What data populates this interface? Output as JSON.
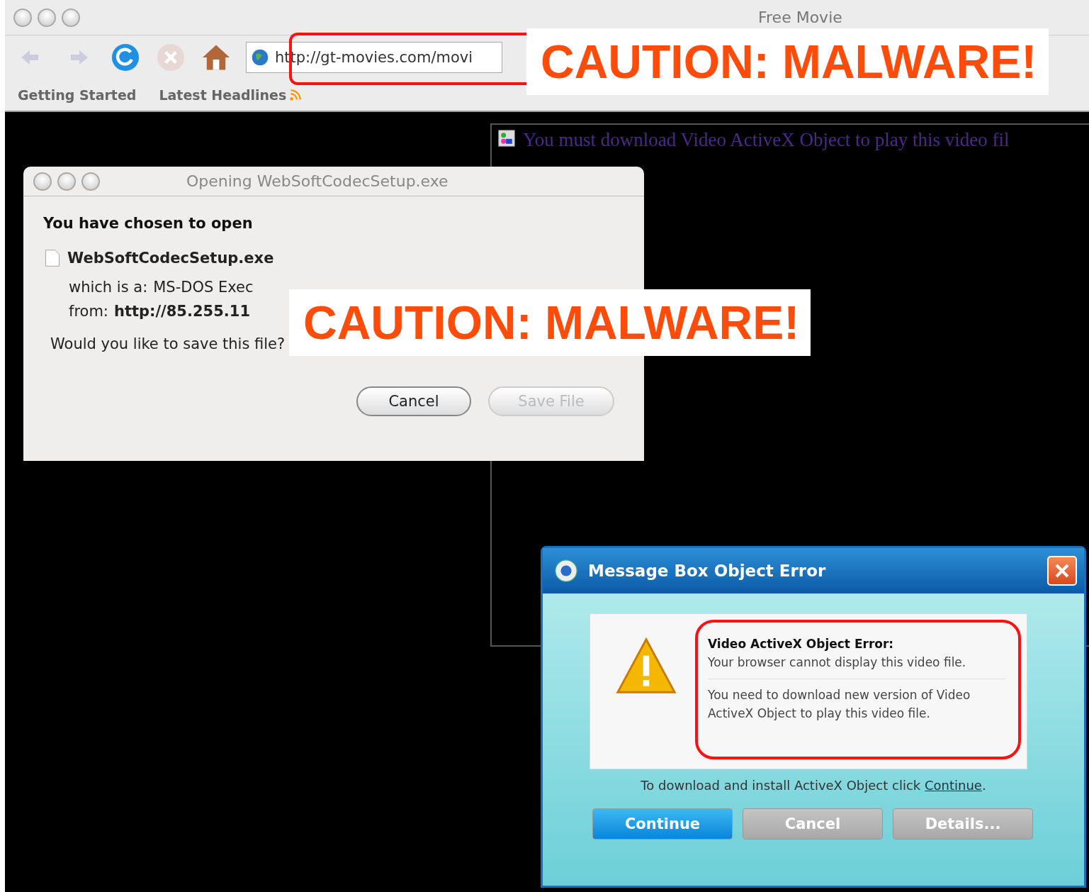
{
  "window": {
    "title": "Free Movie",
    "url": "http://gt-movies.com/movi",
    "bookmarks": [
      {
        "label": "Getting Started",
        "kind": "plain"
      },
      {
        "label": "Latest Headlines",
        "kind": "feed"
      }
    ]
  },
  "page": {
    "message": "You must download Video ActiveX Object to play this video fil"
  },
  "save_dialog": {
    "title": "Opening WebSoftCodecSetup.exe",
    "heading": "You have chosen to open",
    "filename": "WebSoftCodecSetup.exe",
    "type_label": "which is a:",
    "type_value": "MS-DOS Exec",
    "from_label": "from:",
    "from_value": "http://85.255.11",
    "question": "Would you like to save this file?",
    "buttons": [
      {
        "label": "Cancel",
        "disabled": false
      },
      {
        "label": "Save File",
        "disabled": true
      }
    ]
  },
  "error_dialog": {
    "title": "Message Box Object Error",
    "heading": "Video ActiveX Object Error:",
    "message": "Your browser cannot display this video file.",
    "detail": "You need to download new version of Video ActiveX Object to play this video file.",
    "instruction": "To download and install ActiveX Object click",
    "link": "Continue",
    "link_suffix": ".",
    "buttons": [
      {
        "label": "Continue",
        "kind": "primary"
      },
      {
        "label": "Cancel",
        "kind": "normal"
      },
      {
        "label": "Details...",
        "kind": "normal"
      }
    ]
  },
  "cautions": [
    "CAUTION: MALWARE!",
    "CAUTION: MALWARE!"
  ]
}
